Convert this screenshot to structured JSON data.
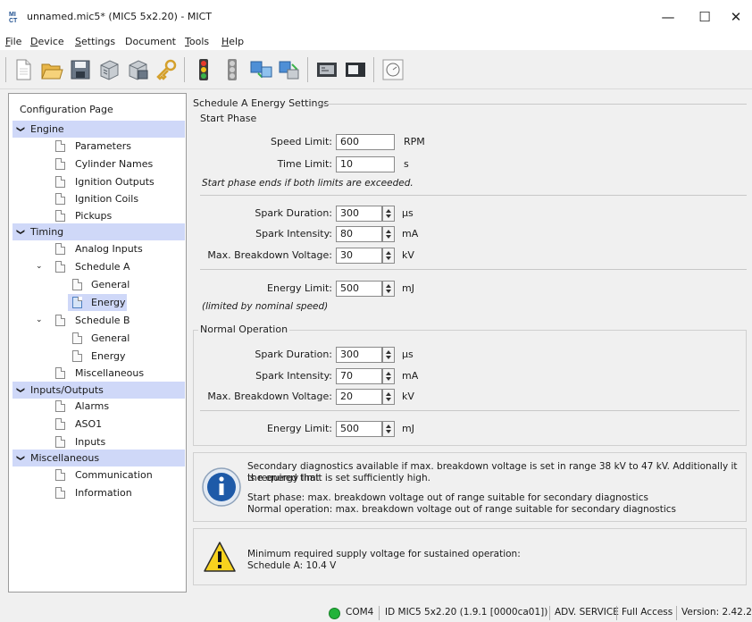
{
  "window": {
    "title": "unnamed.mic5* (MIC5 5x2.20) - MICT",
    "minimize": "—",
    "maximize": "☐",
    "close": "✕"
  },
  "menu": [
    {
      "label": "File",
      "underline": "F",
      "rest": "ile"
    },
    {
      "label": "Device",
      "underline": "D",
      "rest": "evice"
    },
    {
      "label": "Settings",
      "underline": "S",
      "rest": "ettings"
    },
    {
      "label": "Document",
      "underline": "",
      "rest": "Document"
    },
    {
      "label": "Tools",
      "underline": "T",
      "rest": "ools"
    },
    {
      "label": "Help",
      "underline": "H",
      "rest": "elp"
    }
  ],
  "toolbar_icons": [
    "new-file-icon",
    "open-folder-icon",
    "save-icon",
    "read-device-icon",
    "write-device-icon",
    "key-icon",
    "traffic-light-icon",
    "traffic-light-off-icon",
    "transfer-to-device-icon",
    "transfer-from-device-icon",
    "display-icon",
    "dark-display-icon",
    "gauge-icon"
  ],
  "tree": {
    "title": "Configuration Page",
    "groups": {
      "engine": "Engine",
      "timing": "Timing",
      "io": "Inputs/Outputs",
      "misc": "Miscellaneous"
    },
    "items": {
      "parameters": "Parameters",
      "cylinder_names": "Cylinder Names",
      "ignition_outputs": "Ignition Outputs",
      "ignition_coils": "Ignition Coils",
      "pickups": "Pickups",
      "analog_inputs": "Analog Inputs",
      "schedule_a": "Schedule A",
      "a_general": "General",
      "a_energy": "Energy",
      "schedule_b": "Schedule B",
      "b_general": "General",
      "b_energy": "Energy",
      "timing_misc": "Miscellaneous",
      "alarms": "Alarms",
      "aso1": "ASO1",
      "inputs": "Inputs",
      "communication": "Communication",
      "information": "Information"
    },
    "selected": "a_energy"
  },
  "panel": {
    "title": "Schedule A Energy Settings",
    "start": {
      "title": "Start Phase",
      "speed_limit_label": "Speed Limit:",
      "speed_limit_value": "600",
      "speed_limit_unit": "RPM",
      "time_limit_label": "Time Limit:",
      "time_limit_value": "10",
      "time_limit_unit": "s",
      "note": "Start phase ends if both limits are exceeded.",
      "spark_duration_label": "Spark Duration:",
      "spark_duration_value": "300",
      "spark_duration_unit": "µs",
      "spark_intensity_label": "Spark Intensity:",
      "spark_intensity_value": "80",
      "spark_intensity_unit": "mA",
      "breakdown_label": "Max. Breakdown Voltage:",
      "breakdown_value": "30",
      "breakdown_unit": "kV",
      "energy_label": "Energy Limit:",
      "energy_value": "500",
      "energy_unit": "mJ",
      "energy_note": "(limited by nominal speed)"
    },
    "normal": {
      "title": "Normal Operation",
      "spark_duration_label": "Spark Duration:",
      "spark_duration_value": "300",
      "spark_duration_unit": "µs",
      "spark_intensity_label": "Spark Intensity:",
      "spark_intensity_value": "70",
      "spark_intensity_unit": "mA",
      "breakdown_label": "Max. Breakdown Voltage:",
      "breakdown_value": "20",
      "breakdown_unit": "kV",
      "energy_label": "Energy Limit:",
      "energy_value": "500",
      "energy_unit": "mJ"
    },
    "info": {
      "line1": "Secondary diagnostics available if max. breakdown voltage is set in range 38 kV to 47 kV. Additionally it is required that",
      "line2": "the energy limit is set sufficiently high.",
      "line3": "Start phase: max. breakdown voltage out of range suitable for secondary diagnostics",
      "line4": "Normal operation: max. breakdown voltage out of range suitable for secondary diagnostics"
    },
    "warning": {
      "line1": "Minimum required supply voltage for sustained operation:",
      "line2": "Schedule A: 10.4 V"
    }
  },
  "status": {
    "port": "COM4",
    "device_id": "ID MIC5 5x2.20 (1.9.1 [0000ca01])",
    "mode": "ADV. SERVICE",
    "access": "Full Access",
    "version": "Version: 2.42.2",
    "connection_color": "#22b33a"
  }
}
